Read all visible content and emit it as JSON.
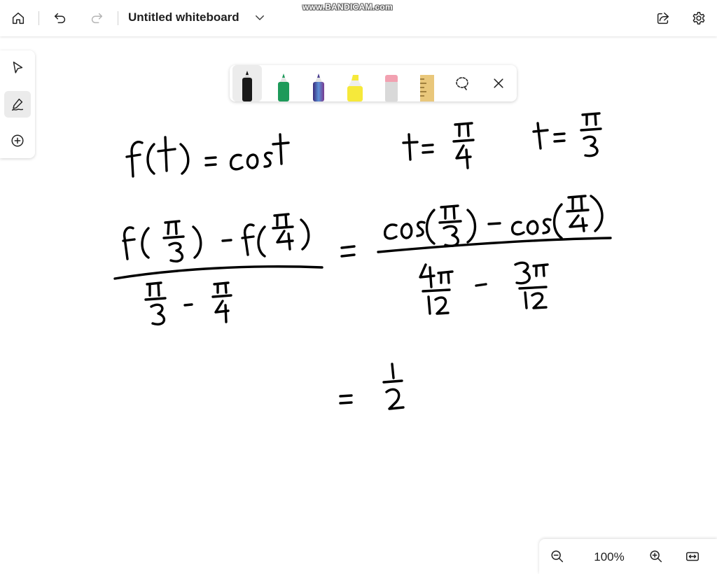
{
  "app": {
    "title": "Untitled whiteboard",
    "watermark": "www.BANDICAM.com"
  },
  "topbar": {
    "icons": [
      "home-icon",
      "undo-icon",
      "redo-icon",
      "chevron-down-icon",
      "share-icon",
      "gear-icon"
    ]
  },
  "left_toolbar": {
    "tools": [
      "select-pointer-icon",
      "inking-tool-icon",
      "add-icon"
    ],
    "active": "inking-tool-icon"
  },
  "pen_tray": {
    "pens": [
      {
        "name": "black-pen",
        "color": "#1a1a1a",
        "active": true
      },
      {
        "name": "green-pen",
        "color": "#1e9a5a"
      },
      {
        "name": "galaxy-pen",
        "color": "#4b3f8f"
      },
      {
        "name": "yellow-highlighter",
        "color": "#f6e93a"
      },
      {
        "name": "eraser",
        "color": "#f2a1b1"
      },
      {
        "name": "ruler",
        "color": "#e9c77b"
      }
    ],
    "icons": [
      "lasso-select-icon",
      "close-icon"
    ]
  },
  "canvas": {
    "ink_color": "#000000"
  },
  "zoom": {
    "level": "100%",
    "icons": [
      "zoom-out-icon",
      "zoom-in-icon",
      "fit-to-screen-icon"
    ]
  }
}
